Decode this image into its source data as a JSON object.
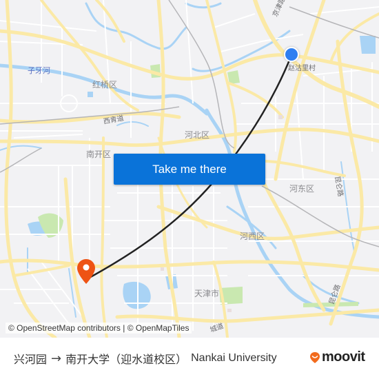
{
  "map": {
    "labels": {
      "hongqiao": "红桥区",
      "ziyahe": "子牙河",
      "xiqingdao": "西青道",
      "hebei": "河北区",
      "nankai": "南开区",
      "hedong": "河东区",
      "hexi": "河西区",
      "tianjin": "天津市",
      "zhaoguli": "赵沽里村",
      "kunlunlu_1": "昆仑路",
      "kunlunlu_2": "昆仑路",
      "jingjin": "京津路",
      "chengdao": "城道"
    },
    "attribution": "© OpenStreetMap contributors | © OpenMapTiles",
    "colors": {
      "background": "#f2f2f4",
      "road_major": "#fbe9a6",
      "road_minor": "#ffffff",
      "water": "#a9d3f5",
      "park": "#c9e8b0",
      "rail": "#b5b5b8",
      "route_line": "#222222",
      "origin": "#2f7ff1",
      "destination": "#ee5314"
    }
  },
  "cta": {
    "label": "Take me there",
    "color": "#0a73d9"
  },
  "footer": {
    "origin": "兴河园",
    "arrow": "→",
    "destination_cn": "南开大学（迎水道校区）",
    "destination_en": "Nankai University",
    "brand": "moovit",
    "brand_color": "#f26b1d"
  }
}
